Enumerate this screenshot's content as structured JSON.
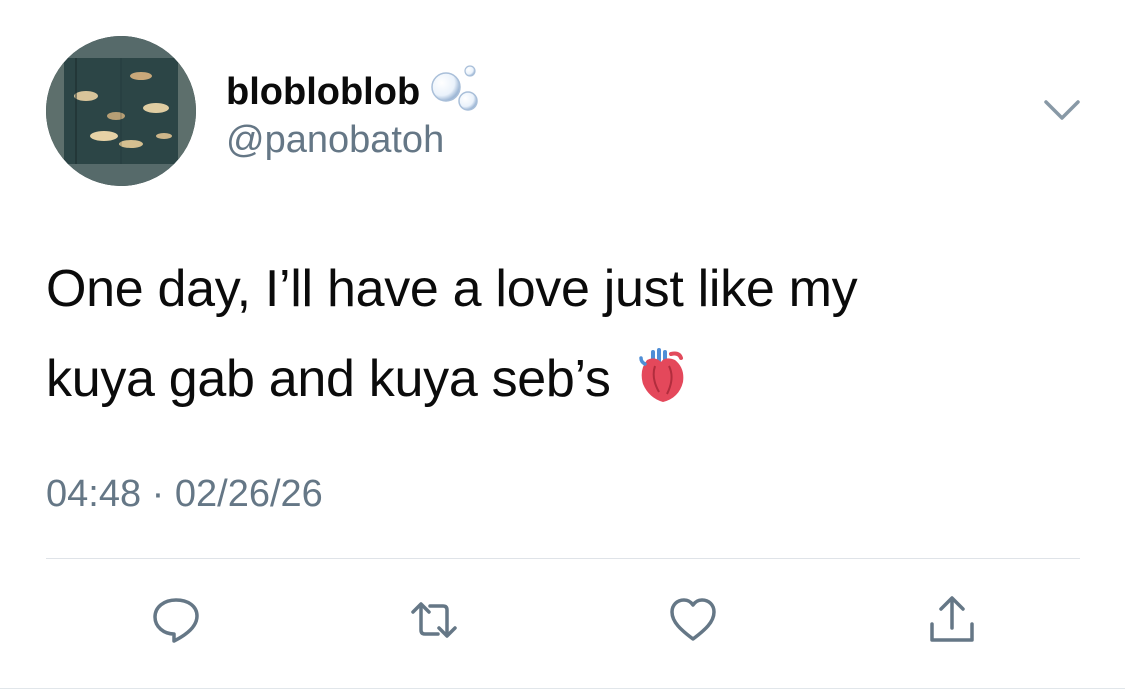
{
  "user": {
    "display_name": "blobloblob",
    "handle": "@panobatoh",
    "name_emoji": "bubbles-emoji",
    "avatar": "fish-tank-avatar"
  },
  "tweet": {
    "text_line1": "One day, I’ll have a love just like my",
    "text_line2": "kuya gab and kuya seb’s",
    "emoji": "anatomical-heart-emoji",
    "timestamp": "04:48 · 02/26/26"
  },
  "actions": [
    {
      "name": "reply",
      "icon": "reply-icon"
    },
    {
      "name": "retweet",
      "icon": "retweet-icon"
    },
    {
      "name": "like",
      "icon": "heart-icon"
    },
    {
      "name": "share",
      "icon": "share-icon"
    }
  ],
  "colors": {
    "text": "#0b0b0b",
    "secondary": "#657786",
    "divider": "#dfe3e8"
  }
}
